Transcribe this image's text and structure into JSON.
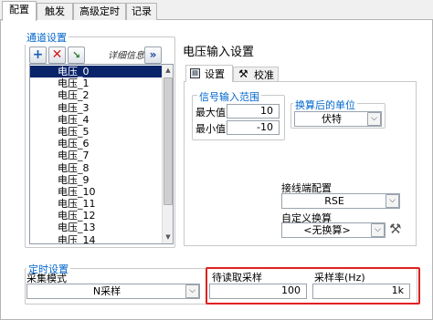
{
  "tabs": [
    "配置",
    "触发",
    "高级定时",
    "记录"
  ],
  "channel_settings": {
    "title": "通道设置",
    "details_label": "详细信息",
    "channels": [
      "电压_0",
      "电压_1",
      "电压_2",
      "电压_3",
      "电压_4",
      "电压_5",
      "电压_6",
      "电压_7",
      "电压_8",
      "电压_9",
      "电压_10",
      "电压_11",
      "电压_12",
      "电压_13",
      "电压_14"
    ],
    "selected_index": 0
  },
  "voltage_input": {
    "title": "电压输入设置",
    "tab_settings": "设置",
    "tab_calibration": "校准",
    "signal_range": {
      "title": "信号输入范围",
      "max_label": "最大值",
      "max_value": "10",
      "min_label": "最小值",
      "min_value": "-10"
    },
    "scaled_units": {
      "title": "换算后的单位",
      "value": "伏特"
    },
    "terminal_config": {
      "label": "接线端配置",
      "value": "RSE"
    },
    "custom_scale": {
      "label": "自定义换算",
      "value": "<无换算>"
    }
  },
  "timing": {
    "title": "定时设置",
    "mode_label": "采集模式",
    "mode_value": "N采样",
    "samples_label": "待读取采样",
    "samples_value": "100",
    "rate_label": "采样率(Hz)",
    "rate_value": "1k"
  },
  "colors": {
    "highlight_border": "#e02020",
    "group_title": "#0066cc",
    "selection": "#0a246a"
  }
}
